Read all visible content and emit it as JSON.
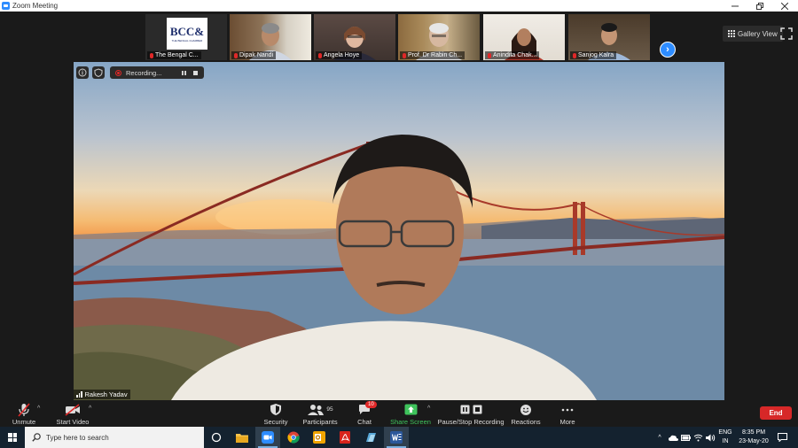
{
  "window": {
    "title": "Zoom Meeting"
  },
  "gallery": {
    "participants": [
      {
        "name": "The Bengal C..."
      },
      {
        "name": "Dipak Nandi"
      },
      {
        "name": "Angela Hoye"
      },
      {
        "name": "Prof. Dr Rabin Ch..."
      },
      {
        "name": "Anindita Chak..."
      },
      {
        "name": "Sanjog Kalra"
      }
    ],
    "logo_text": "BCC&",
    "logo_subtext": "THE BENGAL CHAMBER",
    "view_label": "Gallery View"
  },
  "recording": {
    "label": "Recording..."
  },
  "speaker": {
    "name": "Rakesh Yadav"
  },
  "toolbar": {
    "unmute": "Unmute",
    "start_video": "Start Video",
    "security": "Security",
    "participants": "Participants",
    "participants_count": "95",
    "chat": "Chat",
    "chat_badge": "10",
    "share_screen": "Share Screen",
    "recording": "Pause/Stop Recording",
    "reactions": "Reactions",
    "more": "More",
    "end": "End"
  },
  "taskbar": {
    "search_placeholder": "Type here to search",
    "lang_top": "ENG",
    "lang_bottom": "IN",
    "time": "8:35 PM",
    "date": "23-May-20"
  },
  "colors": {
    "zoom_blue": "#2d8cff",
    "end_red": "#d72828",
    "share_green": "#3fc35c"
  }
}
